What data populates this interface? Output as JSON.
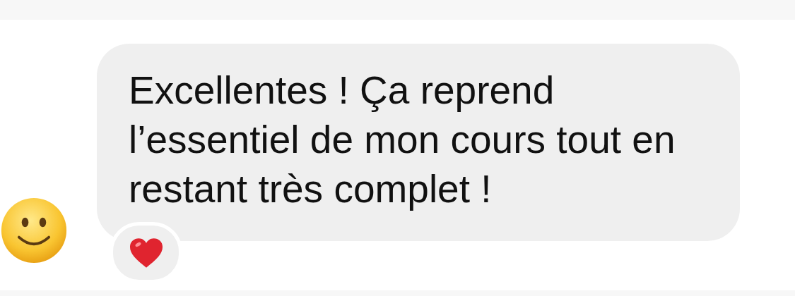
{
  "sender_avatar": {
    "kind": "smiley"
  },
  "message": {
    "text": "Excellentes ! Ça reprend l’essentiel de mon cours tout en restant très complet !",
    "reaction": {
      "kind": "heart"
    }
  }
}
